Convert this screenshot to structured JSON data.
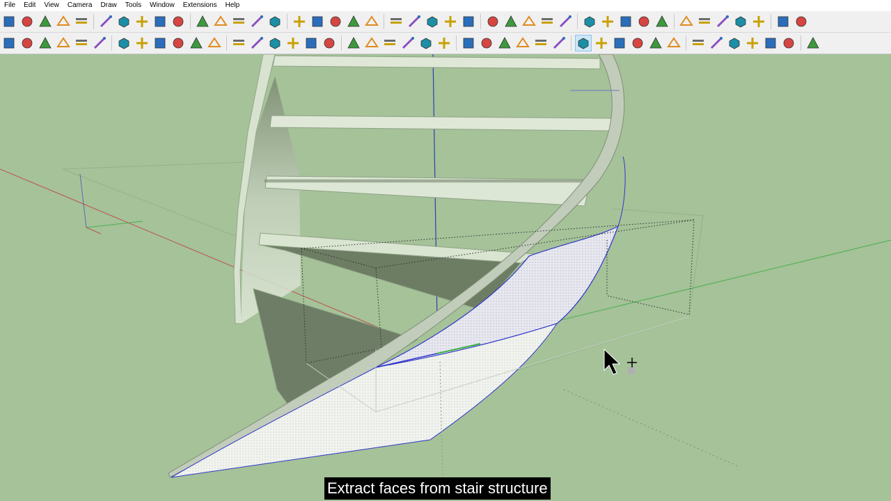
{
  "menu": [
    "File",
    "Edit",
    "View",
    "Camera",
    "Draw",
    "Tools",
    "Window",
    "Extensions",
    "Help"
  ],
  "toolbar_row_1_icons": [
    "select-arrow",
    "make-component",
    "erase-component",
    "align-stack-1",
    "align-stack-2",
    "align-stack-3",
    "distribute-1",
    "distribute-2",
    "distribute-3",
    "section-plane",
    "section-cut",
    "section-fill",
    "grid-select",
    "grid-table",
    "grid-cross",
    "terrain-mesh",
    "terrain-drape",
    "stamp-helmet",
    "checker-pattern",
    "select-flip",
    "pin-vertex",
    "rotate-axes",
    "split-grid",
    "join-grid",
    "trim-pipe",
    "trim-cross",
    "trim-window",
    "pen-draw",
    "texture-paint",
    "component-green",
    "component-gray",
    "axis-blue",
    "move-blue",
    "move-red",
    "line-blue",
    "x-shape",
    "curve-1",
    "curve-2",
    "curve-3",
    "red-shape",
    "red-axes",
    "blue-axes"
  ],
  "toolbar_row_2_icons": [
    "blue-cube",
    "blue-face",
    "gray-face",
    "red-face",
    "orange-ring",
    "orange-spiral",
    "flag-outline",
    "red-cross",
    "green-cross",
    "blue-cross",
    "orange-box",
    "leaf-shape",
    "pencil-red",
    "box-open",
    "cylinder",
    "torus",
    "torus-2",
    "slab",
    "curve-draw",
    "tube-orange",
    "cone-yellow",
    "drop-blue",
    "spiral-tool",
    "red-ring-tool",
    "pink-eraser",
    "polygon-tool",
    "green-sphere",
    "red-sphere",
    "gray-shape",
    "brick-face",
    "glow-cube",
    "cylinder-vertical",
    "blue-helmet",
    "select-edges",
    "star-burst",
    "solid-cube",
    "round-cube",
    "color-wheel",
    "curve-pink",
    "dice-1",
    "dice-2",
    "dice-3",
    "brush-red"
  ],
  "active_tool_icon": "glow-cube",
  "colors": {
    "viewport_background": "#a5c299",
    "x_axis": "#c0504d",
    "y_axis": "#4caf50",
    "z_axis": "#2b3fae",
    "selection_edge": "#2f36c9",
    "selected_face": "#e6e6ef"
  },
  "caption": "Extract faces from stair structure"
}
